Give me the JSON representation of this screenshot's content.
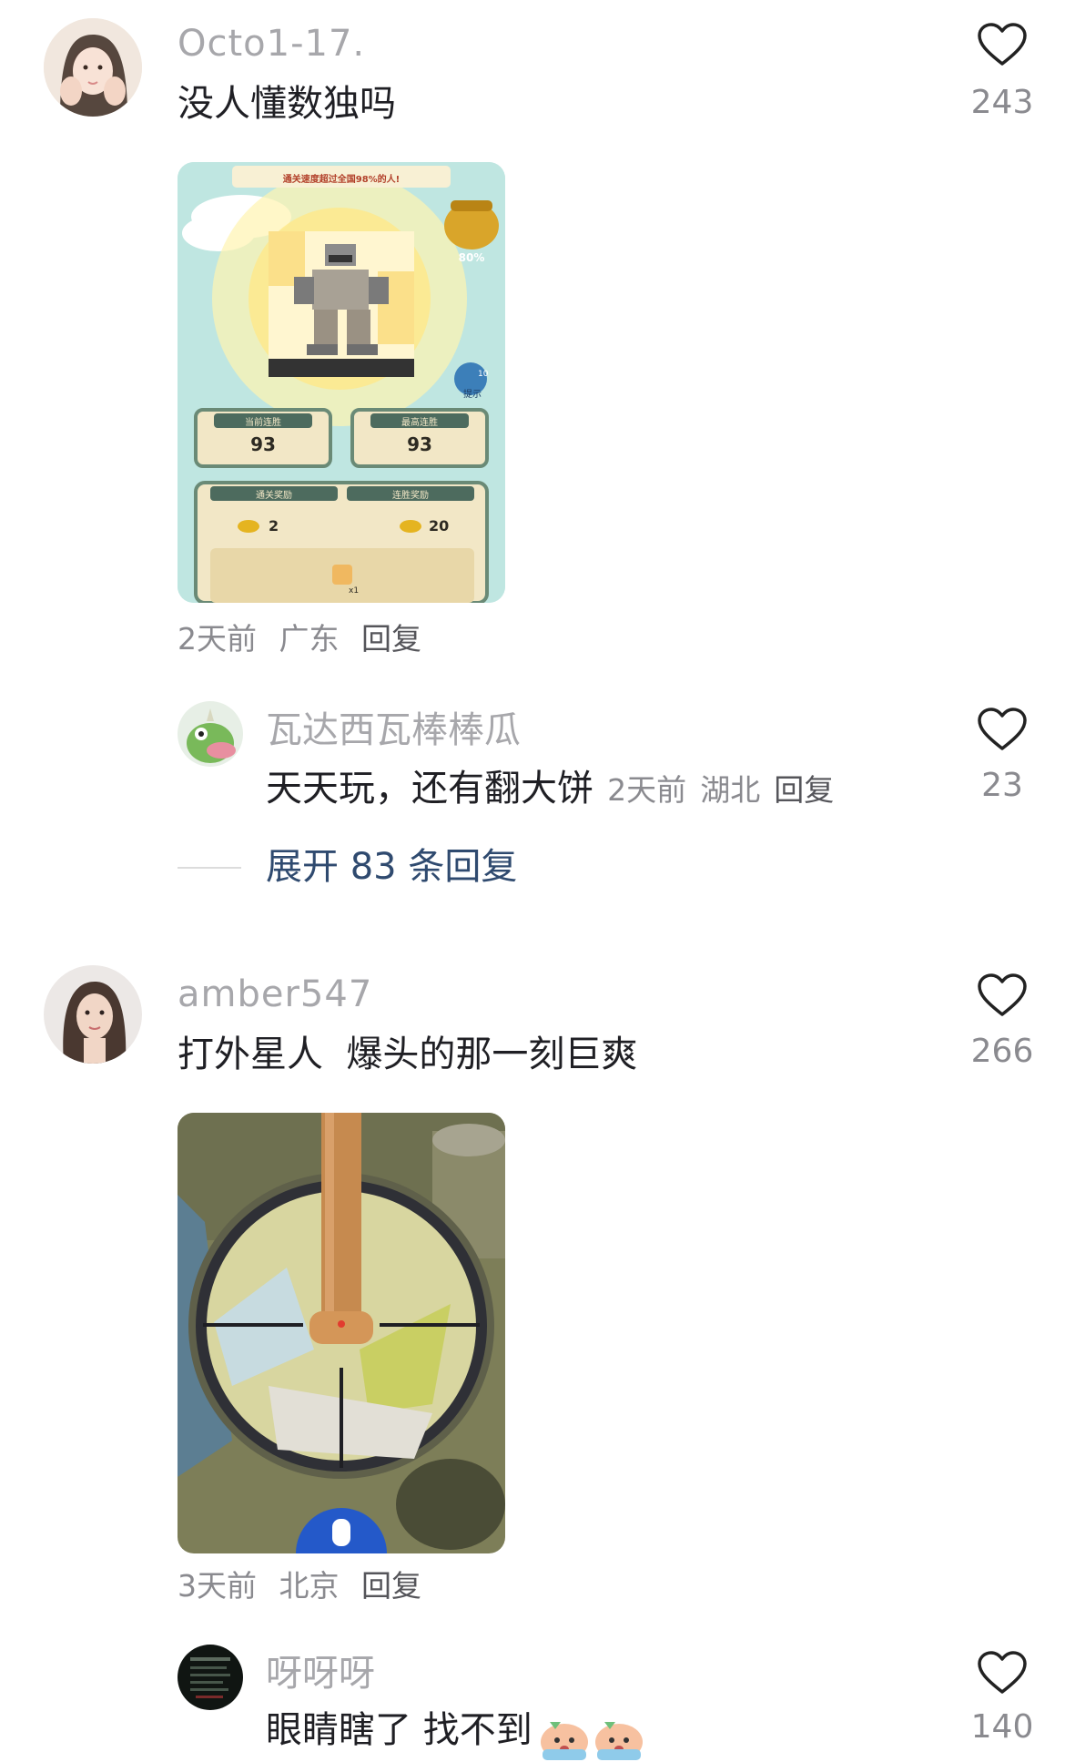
{
  "comments": [
    {
      "username": "Octo1-17.",
      "text": "没人懂数独吗",
      "likes": "243",
      "meta": {
        "time": "2天前",
        "location": "广东",
        "reply": "回复"
      },
      "image": {
        "banner": "通关速度超过全国98%的人!",
        "badge": "80%",
        "hint": "提示",
        "hint_count": "10",
        "stat1_label": "当前连胜",
        "stat1_value": "93",
        "stat2_label": "最高连胜",
        "stat2_value": "93",
        "reward1_label": "通关奖励",
        "reward1_value": "2",
        "reward2_label": "连胜奖励",
        "reward2_value": "20",
        "puzzle_count": "x1"
      },
      "reply": {
        "username": "瓦达西瓦棒棒瓜",
        "text": "天天玩，还有翻大饼",
        "meta": {
          "time": "2天前",
          "location": "湖北",
          "reply": "回复"
        },
        "likes": "23"
      },
      "expand": "展开 83 条回复"
    },
    {
      "username": "amber547",
      "text": "打外星人  爆头的那一刻巨爽",
      "likes": "266",
      "meta": {
        "time": "3天前",
        "location": "北京",
        "reply": "回复"
      },
      "reply": {
        "username": "呀呀呀",
        "text": "眼睛瞎了 找不到",
        "likes": "140"
      }
    }
  ],
  "icons": {
    "like": "heart-outline-icon"
  },
  "colors": {
    "meta": "#8a8a8f",
    "expand": "#2f4a6f",
    "username": "#a7a7ab"
  }
}
